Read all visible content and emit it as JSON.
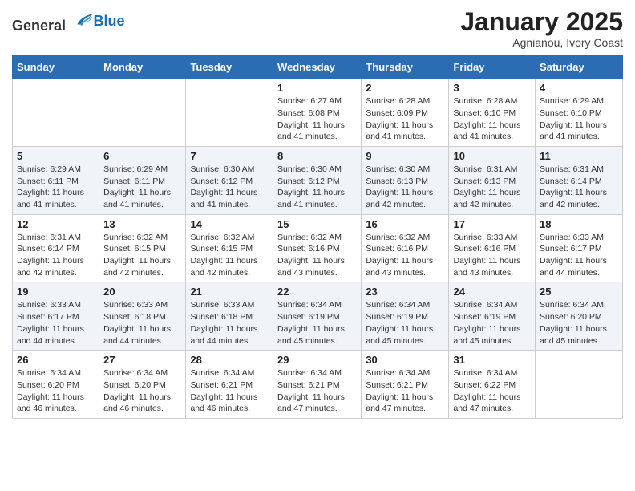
{
  "logo": {
    "general": "General",
    "blue": "Blue"
  },
  "title": "January 2025",
  "subtitle": "Agnianou, Ivory Coast",
  "weekdays": [
    "Sunday",
    "Monday",
    "Tuesday",
    "Wednesday",
    "Thursday",
    "Friday",
    "Saturday"
  ],
  "weeks": [
    [
      {
        "day": "",
        "info": ""
      },
      {
        "day": "",
        "info": ""
      },
      {
        "day": "",
        "info": ""
      },
      {
        "day": "1",
        "info": "Sunrise: 6:27 AM\nSunset: 6:08 PM\nDaylight: 11 hours and 41 minutes."
      },
      {
        "day": "2",
        "info": "Sunrise: 6:28 AM\nSunset: 6:09 PM\nDaylight: 11 hours and 41 minutes."
      },
      {
        "day": "3",
        "info": "Sunrise: 6:28 AM\nSunset: 6:10 PM\nDaylight: 11 hours and 41 minutes."
      },
      {
        "day": "4",
        "info": "Sunrise: 6:29 AM\nSunset: 6:10 PM\nDaylight: 11 hours and 41 minutes."
      }
    ],
    [
      {
        "day": "5",
        "info": "Sunrise: 6:29 AM\nSunset: 6:11 PM\nDaylight: 11 hours and 41 minutes."
      },
      {
        "day": "6",
        "info": "Sunrise: 6:29 AM\nSunset: 6:11 PM\nDaylight: 11 hours and 41 minutes."
      },
      {
        "day": "7",
        "info": "Sunrise: 6:30 AM\nSunset: 6:12 PM\nDaylight: 11 hours and 41 minutes."
      },
      {
        "day": "8",
        "info": "Sunrise: 6:30 AM\nSunset: 6:12 PM\nDaylight: 11 hours and 41 minutes."
      },
      {
        "day": "9",
        "info": "Sunrise: 6:30 AM\nSunset: 6:13 PM\nDaylight: 11 hours and 42 minutes."
      },
      {
        "day": "10",
        "info": "Sunrise: 6:31 AM\nSunset: 6:13 PM\nDaylight: 11 hours and 42 minutes."
      },
      {
        "day": "11",
        "info": "Sunrise: 6:31 AM\nSunset: 6:14 PM\nDaylight: 11 hours and 42 minutes."
      }
    ],
    [
      {
        "day": "12",
        "info": "Sunrise: 6:31 AM\nSunset: 6:14 PM\nDaylight: 11 hours and 42 minutes."
      },
      {
        "day": "13",
        "info": "Sunrise: 6:32 AM\nSunset: 6:15 PM\nDaylight: 11 hours and 42 minutes."
      },
      {
        "day": "14",
        "info": "Sunrise: 6:32 AM\nSunset: 6:15 PM\nDaylight: 11 hours and 42 minutes."
      },
      {
        "day": "15",
        "info": "Sunrise: 6:32 AM\nSunset: 6:16 PM\nDaylight: 11 hours and 43 minutes."
      },
      {
        "day": "16",
        "info": "Sunrise: 6:32 AM\nSunset: 6:16 PM\nDaylight: 11 hours and 43 minutes."
      },
      {
        "day": "17",
        "info": "Sunrise: 6:33 AM\nSunset: 6:16 PM\nDaylight: 11 hours and 43 minutes."
      },
      {
        "day": "18",
        "info": "Sunrise: 6:33 AM\nSunset: 6:17 PM\nDaylight: 11 hours and 44 minutes."
      }
    ],
    [
      {
        "day": "19",
        "info": "Sunrise: 6:33 AM\nSunset: 6:17 PM\nDaylight: 11 hours and 44 minutes."
      },
      {
        "day": "20",
        "info": "Sunrise: 6:33 AM\nSunset: 6:18 PM\nDaylight: 11 hours and 44 minutes."
      },
      {
        "day": "21",
        "info": "Sunrise: 6:33 AM\nSunset: 6:18 PM\nDaylight: 11 hours and 44 minutes."
      },
      {
        "day": "22",
        "info": "Sunrise: 6:34 AM\nSunset: 6:19 PM\nDaylight: 11 hours and 45 minutes."
      },
      {
        "day": "23",
        "info": "Sunrise: 6:34 AM\nSunset: 6:19 PM\nDaylight: 11 hours and 45 minutes."
      },
      {
        "day": "24",
        "info": "Sunrise: 6:34 AM\nSunset: 6:19 PM\nDaylight: 11 hours and 45 minutes."
      },
      {
        "day": "25",
        "info": "Sunrise: 6:34 AM\nSunset: 6:20 PM\nDaylight: 11 hours and 45 minutes."
      }
    ],
    [
      {
        "day": "26",
        "info": "Sunrise: 6:34 AM\nSunset: 6:20 PM\nDaylight: 11 hours and 46 minutes."
      },
      {
        "day": "27",
        "info": "Sunrise: 6:34 AM\nSunset: 6:20 PM\nDaylight: 11 hours and 46 minutes."
      },
      {
        "day": "28",
        "info": "Sunrise: 6:34 AM\nSunset: 6:21 PM\nDaylight: 11 hours and 46 minutes."
      },
      {
        "day": "29",
        "info": "Sunrise: 6:34 AM\nSunset: 6:21 PM\nDaylight: 11 hours and 47 minutes."
      },
      {
        "day": "30",
        "info": "Sunrise: 6:34 AM\nSunset: 6:21 PM\nDaylight: 11 hours and 47 minutes."
      },
      {
        "day": "31",
        "info": "Sunrise: 6:34 AM\nSunset: 6:22 PM\nDaylight: 11 hours and 47 minutes."
      },
      {
        "day": "",
        "info": ""
      }
    ]
  ]
}
